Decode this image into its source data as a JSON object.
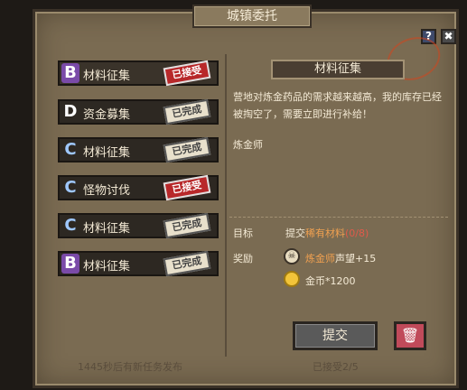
{
  "window": {
    "title": "城镇委托",
    "help_label": "?",
    "close_label": "✖"
  },
  "quests": [
    {
      "grade": "B",
      "name": "材料征集",
      "status": "已接受",
      "status_type": "accepted",
      "selected": true
    },
    {
      "grade": "D",
      "name": "资金募集",
      "status": "已完成",
      "status_type": "done"
    },
    {
      "grade": "C",
      "name": "材料征集",
      "status": "已完成",
      "status_type": "done"
    },
    {
      "grade": "C",
      "name": "怪物讨伐",
      "status": "已接受",
      "status_type": "accepted"
    },
    {
      "grade": "C",
      "name": "材料征集",
      "status": "已完成",
      "status_type": "done"
    },
    {
      "grade": "B",
      "name": "材料征集",
      "status": "已完成",
      "status_type": "done"
    }
  ],
  "detail": {
    "title": "材料征集",
    "description": "营地对炼金药品的需求越来越高，我的库存已经被掏空了，需要立即进行补给！",
    "giver": "炼金师",
    "goal_label": "目标",
    "goal_prefix": "提交",
    "goal_item": "稀有材料",
    "goal_progress": "(0/8)",
    "reward_label": "奖励",
    "reward_rep_name": "炼金师",
    "reward_rep_text": "声望+15",
    "reward_gold": "金币*1200"
  },
  "buttons": {
    "submit": "提交",
    "delete_icon": "trash-icon"
  },
  "footer": {
    "timer": "1445秒后有新任务发布",
    "accepted_count": "已接受2/5"
  }
}
